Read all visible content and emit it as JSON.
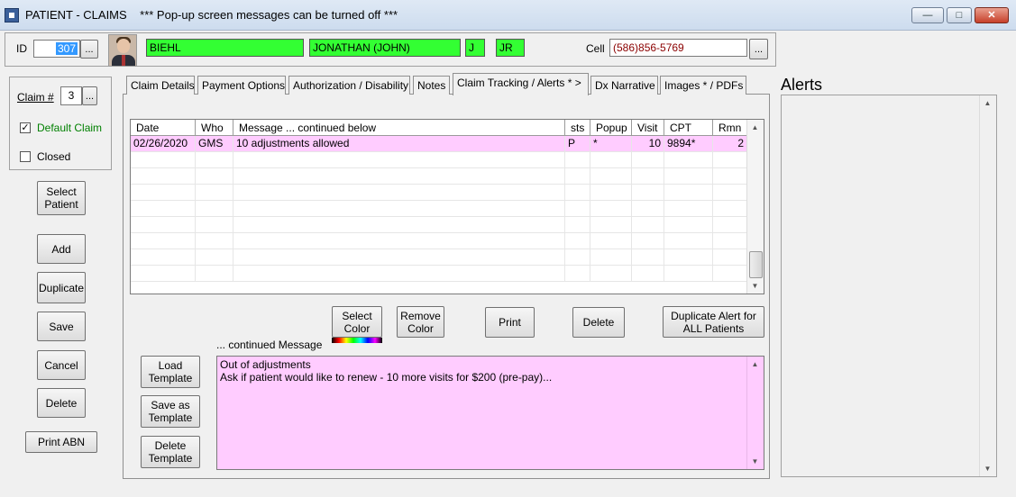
{
  "window": {
    "title": "PATIENT - CLAIMS",
    "subtitle": "*** Pop-up screen messages can be turned off ***",
    "minimize_label": "—",
    "maximize_label": "□",
    "close_label": "✕"
  },
  "patient": {
    "id_label": "ID",
    "id_value": "307",
    "id_lookup_label": "...",
    "last_name": "BIEHL",
    "first_name": "JONATHAN  (JOHN)",
    "middle_initial": "J",
    "suffix": "JR",
    "cell_label": "Cell",
    "cell_value": "(586)856-5769",
    "cell_button_label": "..."
  },
  "claim_panel": {
    "claim_label": "Claim #",
    "claim_value": "3",
    "claim_lookup_label": "...",
    "default_claim_label": "Default Claim",
    "default_claim_checked": "✓",
    "closed_label": "Closed",
    "closed_checked": ""
  },
  "left_buttons": {
    "select_patient": "Select\nPatient",
    "add": "Add",
    "duplicate": "Duplicate",
    "save": "Save",
    "cancel": "Cancel",
    "delete": "Delete",
    "print_abn": "Print ABN"
  },
  "tabs": [
    {
      "label": "Claim Details"
    },
    {
      "label": "Payment Options"
    },
    {
      "label": "Authorization / Disability"
    },
    {
      "label": "Notes"
    },
    {
      "label": "Claim Tracking / Alerts * >"
    },
    {
      "label": "Dx Narrative"
    },
    {
      "label": "Images * / PDFs"
    }
  ],
  "grid": {
    "headers": {
      "date": "Date",
      "who": "Who",
      "message": "Message          ... continued below",
      "sts": "sts",
      "popup": "Popup",
      "visit": "Visit",
      "cpt": "CPT",
      "rmn": "Rmn"
    },
    "rows": [
      {
        "date": "02/26/2020",
        "who": "GMS",
        "message": "10 adjustments allowed",
        "sts": "P",
        "popup": "*",
        "visit": "10",
        "cpt": "9894*",
        "rmn": "2"
      }
    ]
  },
  "action_buttons": {
    "select_color": "Select\nColor",
    "remove_color": "Remove\nColor",
    "print": "Print",
    "delete": "Delete",
    "duplicate_alert": "Duplicate Alert for\nALL Patients"
  },
  "memo": {
    "label": "... continued Message",
    "line1": "Out of adjustments",
    "line2": "Ask if patient would like to renew - 10 more visits for $200 (pre-pay)..."
  },
  "template_buttons": {
    "load": "Load\nTemplate",
    "save_as": "Save as\nTemplate",
    "delete": "Delete\nTemplate"
  },
  "alerts": {
    "title": "Alerts"
  },
  "colors": {
    "green_field": "#33ff33",
    "pink_row": "#ffccff",
    "cell_text": "#8b0000"
  }
}
